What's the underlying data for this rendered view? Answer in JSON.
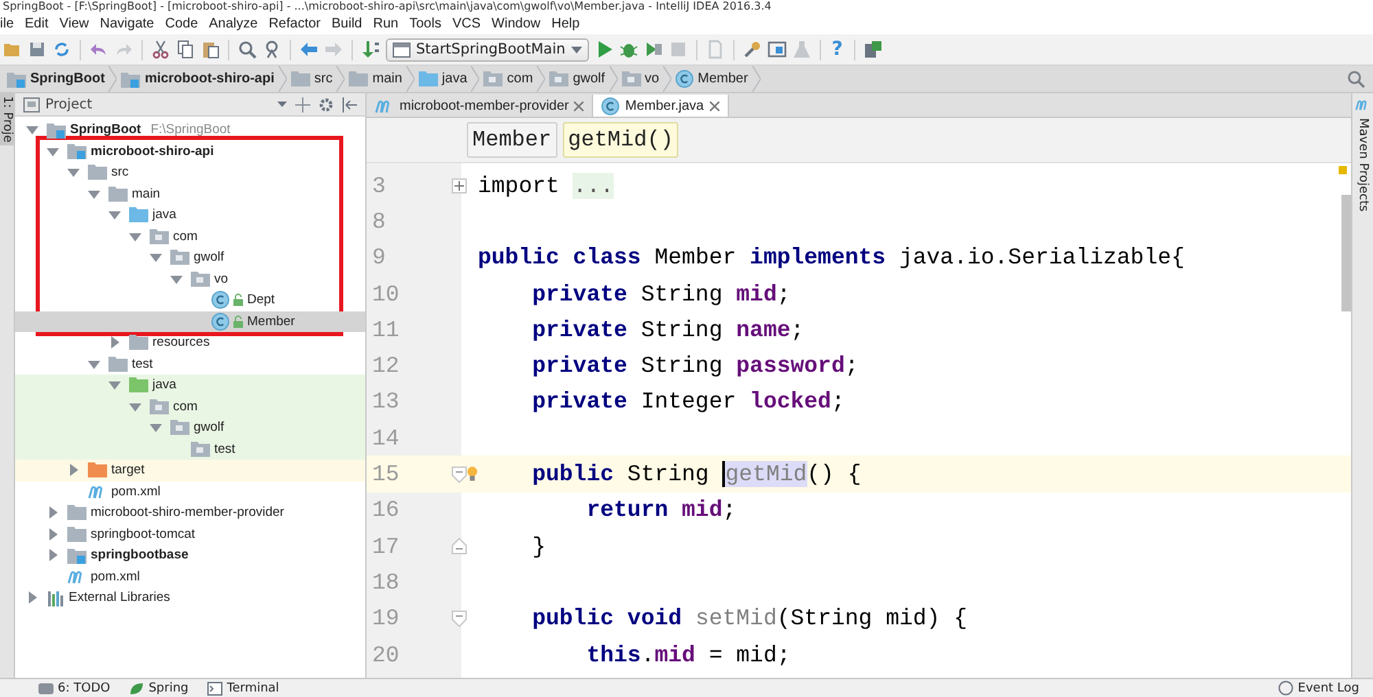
{
  "window": {
    "title": "SpringBoot - [F:\\SpringBoot] - [microboot-shiro-api] - ...\\microboot-shiro-api\\src\\main\\java\\com\\gwolf\\vo\\Member.java - IntelliJ IDEA 2016.3.4"
  },
  "menu": [
    "ile",
    "Edit",
    "View",
    "Navigate",
    "Code",
    "Analyze",
    "Refactor",
    "Build",
    "Run",
    "Tools",
    "VCS",
    "Window",
    "Help"
  ],
  "toolbar": {
    "run_config": "StartSpringBootMain",
    "help_label": "?"
  },
  "breadcrumbs": [
    {
      "label": "SpringBoot",
      "kind": "module",
      "bold": true
    },
    {
      "label": "microboot-shiro-api",
      "kind": "module",
      "bold": true
    },
    {
      "label": "src",
      "kind": "folder",
      "bold": false
    },
    {
      "label": "main",
      "kind": "folder",
      "bold": false
    },
    {
      "label": "java",
      "kind": "source-folder",
      "bold": false
    },
    {
      "label": "com",
      "kind": "package",
      "bold": false
    },
    {
      "label": "gwolf",
      "kind": "package",
      "bold": false
    },
    {
      "label": "vo",
      "kind": "package",
      "bold": false
    },
    {
      "label": "Member",
      "kind": "class",
      "bold": false
    }
  ],
  "left_strip": {
    "label": "1: Proje"
  },
  "project_panel": {
    "title": "Project",
    "tree": [
      {
        "label": "SpringBoot",
        "path": "F:\\SpringBoot",
        "kind": "module",
        "bold": true,
        "expanded": true,
        "selected": false,
        "children": [
          {
            "label": "microboot-shiro-api",
            "kind": "module",
            "bold": true,
            "expanded": true,
            "selected": false,
            "children": [
              {
                "label": "src",
                "kind": "folder",
                "bold": false,
                "expanded": true,
                "selected": false,
                "children": [
                  {
                    "label": "main",
                    "kind": "folder",
                    "bold": false,
                    "expanded": true,
                    "selected": false,
                    "children": [
                      {
                        "label": "java",
                        "kind": "source-folder",
                        "bold": false,
                        "expanded": true,
                        "selected": false,
                        "children": [
                          {
                            "label": "com",
                            "kind": "package",
                            "bold": false,
                            "expanded": true,
                            "selected": false,
                            "children": [
                              {
                                "label": "gwolf",
                                "kind": "package",
                                "bold": false,
                                "expanded": true,
                                "selected": false,
                                "children": [
                                  {
                                    "label": "vo",
                                    "kind": "package",
                                    "bold": false,
                                    "expanded": true,
                                    "selected": false,
                                    "children": [
                                      {
                                        "label": "Dept",
                                        "kind": "class",
                                        "bold": false,
                                        "selected": false
                                      },
                                      {
                                        "label": "Member",
                                        "kind": "class",
                                        "bold": false,
                                        "selected": true
                                      }
                                    ]
                                  }
                                ]
                              }
                            ]
                          }
                        ]
                      },
                      {
                        "label": "resources",
                        "kind": "folder",
                        "bold": false,
                        "expanded": false,
                        "selected": false
                      }
                    ]
                  },
                  {
                    "label": "test",
                    "kind": "folder",
                    "bold": false,
                    "expanded": true,
                    "selected": false,
                    "children": [
                      {
                        "label": "java",
                        "kind": "test-folder",
                        "bold": false,
                        "expanded": true,
                        "selected": false,
                        "children": [
                          {
                            "label": "com",
                            "kind": "test-package",
                            "bold": false,
                            "expanded": true,
                            "selected": false,
                            "children": [
                              {
                                "label": "gwolf",
                                "kind": "test-package",
                                "bold": false,
                                "expanded": true,
                                "selected": false,
                                "children": [
                                  {
                                    "label": "test",
                                    "kind": "test-package",
                                    "bold": false,
                                    "selected": false
                                  }
                                ]
                              }
                            ]
                          }
                        ]
                      }
                    ]
                  }
                ]
              },
              {
                "label": "target",
                "kind": "excluded-folder",
                "bold": false,
                "expanded": false,
                "selected": false
              },
              {
                "label": "pom.xml",
                "kind": "maven",
                "bold": false,
                "selected": false
              }
            ]
          },
          {
            "label": "microboot-shiro-member-provider",
            "kind": "folder",
            "bold": false,
            "expanded": false,
            "selected": false
          },
          {
            "label": "springboot-tomcat",
            "kind": "folder",
            "bold": false,
            "expanded": false,
            "selected": false
          },
          {
            "label": "springbootbase",
            "kind": "module",
            "bold": true,
            "expanded": false,
            "selected": false
          },
          {
            "label": "pom.xml",
            "kind": "maven",
            "bold": false,
            "selected": false
          }
        ]
      },
      {
        "label": "External Libraries",
        "kind": "libraries",
        "bold": false,
        "expanded": false,
        "selected": false
      }
    ]
  },
  "editor_tabs": [
    {
      "label": "microboot-member-provider",
      "kind": "maven",
      "selected": false
    },
    {
      "label": "Member.java",
      "kind": "class",
      "selected": true
    }
  ],
  "editor_breadcrumbs": [
    {
      "label": "Member",
      "selected": false
    },
    {
      "label": "getMid()",
      "selected": true
    }
  ],
  "code_lines": [
    {
      "number": "3",
      "kind": "fold-collapsed",
      "current": false,
      "bulb": false,
      "tokens": [
        {
          "text": "import ",
          "kind": "plain"
        },
        {
          "text": "...",
          "kind": "folded"
        }
      ]
    },
    {
      "number": "8",
      "kind": "plain",
      "current": false,
      "bulb": false
    },
    {
      "number": "9",
      "kind": "plain",
      "current": false,
      "bulb": false,
      "tokens": [
        {
          "text": "public class ",
          "kind": "keyword"
        },
        {
          "text": "Member ",
          "kind": "plain"
        },
        {
          "text": "implements ",
          "kind": "keyword"
        },
        {
          "text": "java.io.Serializable{",
          "kind": "plain"
        }
      ]
    },
    {
      "number": "10",
      "kind": "plain",
      "current": false,
      "bulb": false,
      "tokens": [
        {
          "text": "    private ",
          "kind": "keyword"
        },
        {
          "text": "String ",
          "kind": "plain"
        },
        {
          "text": "mid",
          "kind": "field"
        },
        {
          "text": ";",
          "kind": "plain"
        }
      ]
    },
    {
      "number": "11",
      "kind": "plain",
      "current": false,
      "bulb": false,
      "tokens": [
        {
          "text": "    private ",
          "kind": "keyword"
        },
        {
          "text": "String ",
          "kind": "plain"
        },
        {
          "text": "name",
          "kind": "field"
        },
        {
          "text": ";",
          "kind": "plain"
        }
      ]
    },
    {
      "number": "12",
      "kind": "plain",
      "current": false,
      "bulb": false,
      "tokens": [
        {
          "text": "    private ",
          "kind": "keyword"
        },
        {
          "text": "String ",
          "kind": "plain"
        },
        {
          "text": "password",
          "kind": "field"
        },
        {
          "text": ";",
          "kind": "plain"
        }
      ]
    },
    {
      "number": "13",
      "kind": "plain",
      "current": false,
      "bulb": false,
      "tokens": [
        {
          "text": "    private ",
          "kind": "keyword"
        },
        {
          "text": "Integer ",
          "kind": "plain"
        },
        {
          "text": "locked",
          "kind": "field"
        },
        {
          "text": ";",
          "kind": "plain"
        }
      ]
    },
    {
      "number": "14",
      "kind": "plain",
      "current": false,
      "bulb": false
    },
    {
      "number": "15",
      "kind": "fold-start",
      "current": true,
      "bulb": true,
      "tokens": [
        {
          "text": "    public ",
          "kind": "keyword"
        },
        {
          "text": "String ",
          "kind": "plain"
        },
        {
          "text": "getMid",
          "kind": "unused-selected"
        },
        {
          "text": "() {",
          "kind": "plain"
        }
      ]
    },
    {
      "number": "16",
      "kind": "plain",
      "current": false,
      "bulb": false,
      "tokens": [
        {
          "text": "        return ",
          "kind": "keyword"
        },
        {
          "text": "mid",
          "kind": "field"
        },
        {
          "text": ";",
          "kind": "plain"
        }
      ]
    },
    {
      "number": "17",
      "kind": "fold-end",
      "current": false,
      "bulb": false,
      "tokens": [
        {
          "text": "    }",
          "kind": "plain"
        }
      ]
    },
    {
      "number": "18",
      "kind": "plain",
      "current": false,
      "bulb": false
    },
    {
      "number": "19",
      "kind": "fold-start",
      "current": false,
      "bulb": false,
      "tokens": [
        {
          "text": "    public void ",
          "kind": "keyword"
        },
        {
          "text": "setMid",
          "kind": "unused"
        },
        {
          "text": "(String mid) {",
          "kind": "plain"
        }
      ]
    },
    {
      "number": "20",
      "kind": "plain",
      "current": false,
      "bulb": false,
      "tokens": [
        {
          "text": "        this",
          "kind": "keyword"
        },
        {
          "text": ".",
          "kind": "plain"
        },
        {
          "text": "mid",
          "kind": "field"
        },
        {
          "text": " = mid;",
          "kind": "plain"
        }
      ]
    }
  ],
  "right_strip": {
    "label": "Maven Projects"
  },
  "status_bar": {
    "left_tools": [
      {
        "label": "6: TODO",
        "kind": "todo"
      },
      {
        "label": "Spring",
        "kind": "spring"
      },
      {
        "label": "Terminal",
        "kind": "terminal"
      }
    ],
    "event_log": "Event Log"
  }
}
